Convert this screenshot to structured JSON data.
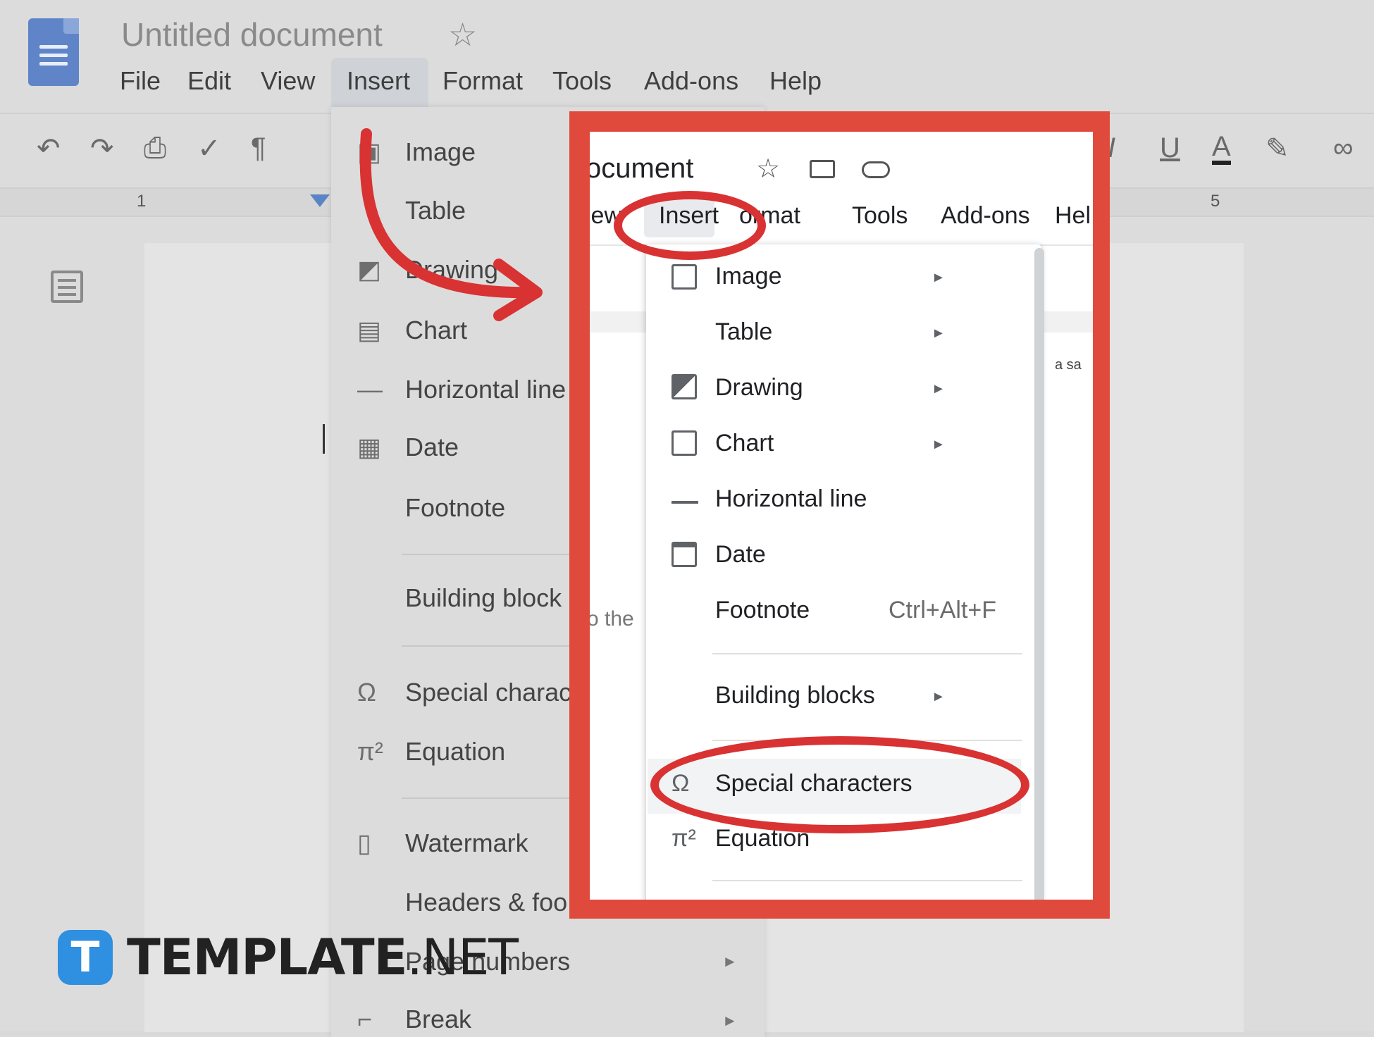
{
  "app": {
    "title": "Untitled document"
  },
  "menubar": [
    "File",
    "Edit",
    "View",
    "Insert",
    "Format",
    "Tools",
    "Add-ons",
    "Help"
  ],
  "bg_menu": {
    "items": [
      "Image",
      "Table",
      "Drawing",
      "Chart",
      "Horizontal line",
      "Date",
      "Footnote",
      "Building block",
      "Special charac",
      "Equation",
      "Watermark",
      "Headers & foo",
      "Page numbers",
      "Break"
    ]
  },
  "ruler": {
    "mark1": "1",
    "mark5": "5"
  },
  "zoom": {
    "title_fragment": "ocument",
    "menubar": [
      "iew",
      "Insert",
      "ormat",
      "Tools",
      "Add-ons",
      "Hel"
    ],
    "page_text": "o the",
    "page_text2": "a sa",
    "dropdown": {
      "items": [
        {
          "label": "Image",
          "icon": "image-icon",
          "submenu": true
        },
        {
          "label": "Table",
          "icon": "",
          "submenu": true
        },
        {
          "label": "Drawing",
          "icon": "drawing-icon",
          "submenu": true
        },
        {
          "label": "Chart",
          "icon": "chart-icon",
          "submenu": true
        },
        {
          "label": "Horizontal line",
          "icon": "horizontal-line-icon",
          "submenu": false
        },
        {
          "label": "Date",
          "icon": "date-icon",
          "submenu": false
        },
        {
          "label": "Footnote",
          "icon": "",
          "shortcut": "Ctrl+Alt+F"
        },
        {
          "label": "Building blocks",
          "icon": "",
          "submenu": true
        },
        {
          "label": "Special characters",
          "icon": "omega-icon",
          "highlighted": true
        },
        {
          "label": "Equation",
          "icon": "pi-icon"
        }
      ]
    }
  },
  "logo": {
    "brand": "TEMPLATE",
    "suffix": ".NET",
    "badge": "T"
  },
  "colors": {
    "annotation_red": "#d93232",
    "frame_red": "#e04a3d",
    "logo_blue": "#2f8fe0"
  }
}
